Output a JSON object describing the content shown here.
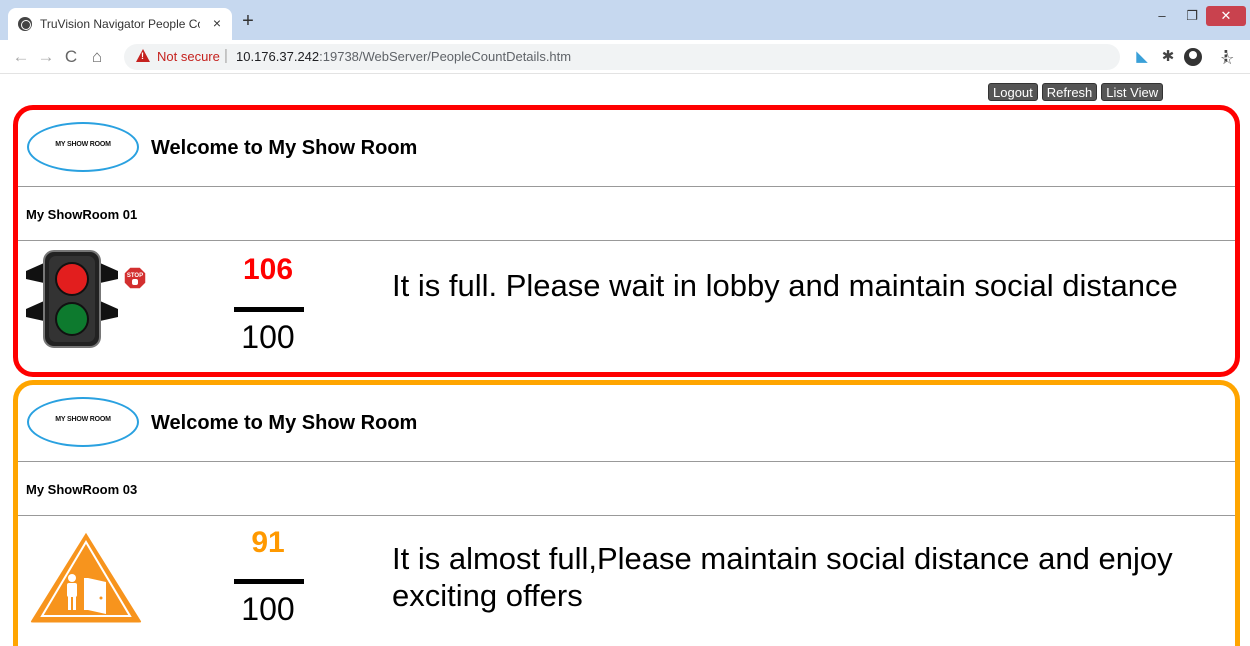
{
  "browser": {
    "tab_title": "TruVision Navigator People Cour",
    "tab_close": "×",
    "new_tab": "+",
    "security_label": "Not secure",
    "url_host": "10.176.37.242",
    "url_rest": ":19738/WebServer/PeopleCountDetails.htm"
  },
  "page": {
    "actions": {
      "logout": "Logout",
      "refresh": "Refresh",
      "list_view": "List View"
    },
    "rooms": [
      {
        "logo_text": "MY SHOW ROOM",
        "welcome": "Welcome to My Show Room",
        "name": "My ShowRoom 01",
        "count": "106",
        "capacity": "100",
        "message": "It is full. Please wait in lobby and maintain social distance",
        "status_icon": "traffic-light-icon",
        "stop_icon": "stop-sign-icon",
        "accent_color": "#ff0000"
      },
      {
        "logo_text": "MY SHOW ROOM",
        "welcome": "Welcome to My Show Room",
        "name": "My ShowRoom 03",
        "count": "91",
        "capacity": "100",
        "message": "It is almost full,Please maintain social distance and enjoy exciting offers",
        "status_icon": "warning-door-icon",
        "accent_color": "#ffa500"
      }
    ]
  }
}
